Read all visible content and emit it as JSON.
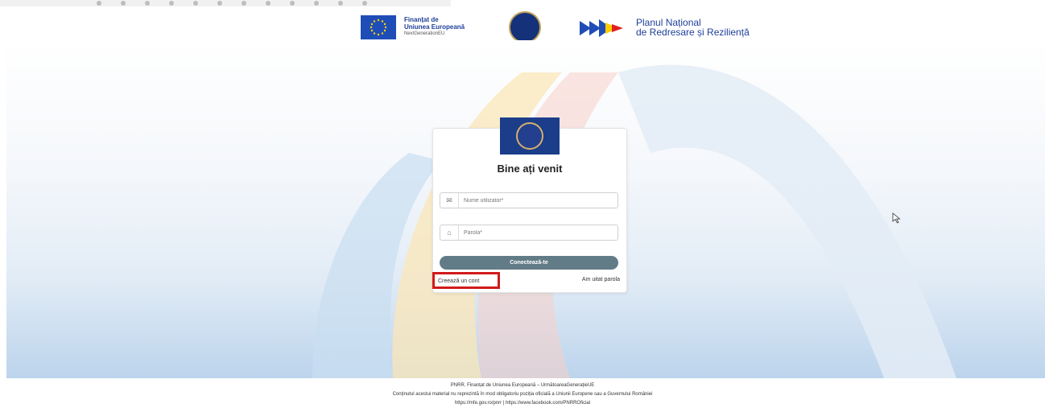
{
  "header": {
    "eu_line1": "Finanțat de",
    "eu_line2": "Uniunea Europeană",
    "eu_line3": "NextGenerationEU",
    "pnrr_line1": "Planul Național",
    "pnrr_line2": "de Redresare și Reziliență"
  },
  "login": {
    "title": "Bine ați venit",
    "username_placeholder": "Nume utilizator*",
    "password_placeholder": "Parola*",
    "submit_label": "Conectează-te",
    "create_account_label": "Creează un cont",
    "forgot_password_label": "Am uitat parola"
  },
  "footer": {
    "line1": "PNRR. Finanțat de Uniunea Europeană – UrmătoareaGenerațieUE",
    "line2": "Conținutul acestui material nu reprezintă în mod obligatoriu poziția oficială a Uniunii Europene sau a Guvernului României",
    "line3": "https://mfe.gov.ro/pnrr | https://www.facebook.com/PNRROficial"
  },
  "colors": {
    "button": "#627c87",
    "highlight_border": "#d11a1a",
    "brand_blue": "#1b3d8a"
  }
}
